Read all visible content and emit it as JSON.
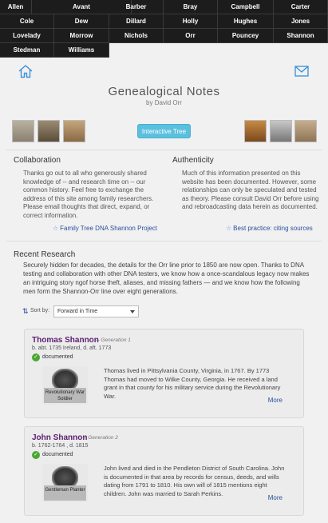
{
  "surname_menu": {
    "rows": [
      [
        "Allen",
        "Avant",
        "Barber",
        "Bray",
        "Campbell",
        "Carter"
      ],
      [
        "Cole",
        "Dew",
        "Dillard",
        "Holly",
        "Hughes",
        "Jones"
      ],
      [
        "Lovelady",
        "Morrow",
        "Nichols",
        "Orr",
        "Pouncey",
        "Shannon"
      ],
      [
        "Stedman",
        "Williams"
      ]
    ]
  },
  "header": {
    "home_icon": "home-icon",
    "mail_icon": "envelope-icon",
    "title": "Genealogical Notes",
    "byline": "by David Orr",
    "interactive_button": "Interactive Tree"
  },
  "collaboration": {
    "heading": "Collaboration",
    "text": "Thanks go out to all who generously shared knowledge of -- and research time on -- our common history. Feel free to exchange the address of this site among family researchers. Please email thoughts that direct, expand, or correct information.",
    "link": "Family Tree DNA Shannon Project"
  },
  "authenticity": {
    "heading": "Authenticity",
    "text": "Much of this information presented on this website has been documented. However, some relationships can only be speculated and tested as theory. Please consult David Orr before using and rebroadcasting data herein as documented.",
    "link": "Best practice: citing sources"
  },
  "recent": {
    "heading": "Recent Research",
    "intro": "Securely hidden for decades, the details for the Orr line prior to 1850 are now open. Thanks to DNA testing and collaboration with other DNA testers, we know how a once-scandalous legacy now makes an intriguing story ngof horse theft, aliases, and missing fathers — and we know how the following men form the Shannon-Orr line over eight generations.",
    "sort_label": "Sort by:",
    "sort_value": "Forward in Time"
  },
  "people": [
    {
      "name": "Thomas Shannon",
      "generation": "— Generation 1",
      "dates": "b. abt. 1735 Ireland, d. aft. 1773",
      "status": "documented",
      "caption": "Revolutionary War Soldier",
      "bio": "Thomas lived in Pittsylvania County, Virginia, in 1767. By 1773 Thomas had moved to Wilke County, Georgia. He received a land grant in that county for his military service during the Revolutionary War.",
      "more": "More"
    },
    {
      "name": "John Shannon",
      "generation": "— Generation 2",
      "dates": "b. 1762-1764 , d. 1815",
      "status": "documented",
      "caption": "Gentleman Planter",
      "bio": "John lived and died in the Pendleton District of South Carolina. John is documented in that area by records for census, deeds, and wills dating from 1791 to 1810. His own will of 1815 mentions eight children. John was married to Sarah Perkins.",
      "more": "More"
    }
  ],
  "colors": {
    "menu_bg": "#1c1c1c",
    "accent_button": "#5bc0de",
    "link": "#2a4f9b",
    "name": "#5b1f6e",
    "check": "#4aa832"
  }
}
